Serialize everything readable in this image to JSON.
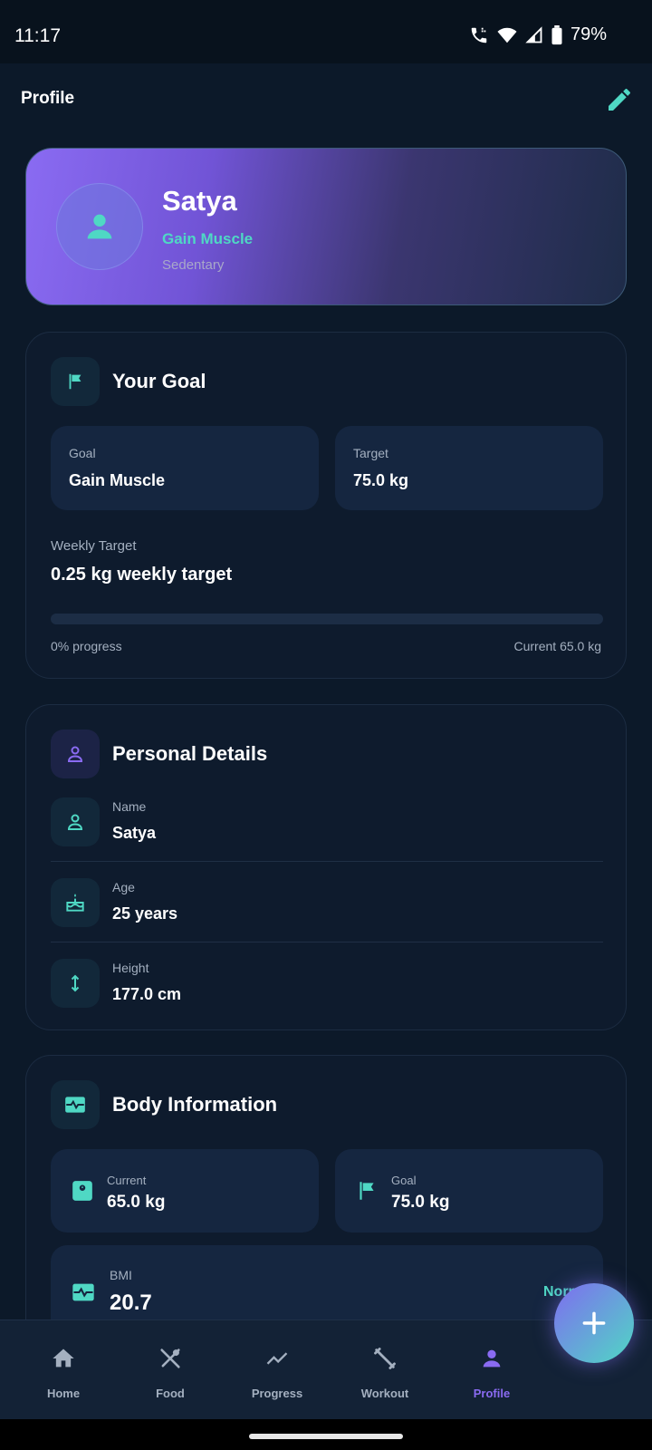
{
  "status_bar": {
    "time": "11:17",
    "battery": "79%"
  },
  "header": {
    "title": "Profile"
  },
  "profile": {
    "name": "Satya",
    "goal": "Gain Muscle",
    "activity": "Sedentary"
  },
  "goal_card": {
    "title": "Your Goal",
    "goal_label": "Goal",
    "goal_value": "Gain Muscle",
    "target_label": "Target",
    "target_value": "75.0 kg",
    "weekly_label": "Weekly Target",
    "weekly_value": "0.25 kg weekly target",
    "progress_fraction": 0,
    "progress_text": "0% progress",
    "current_text": "Current 65.0 kg"
  },
  "personal_card": {
    "title": "Personal Details",
    "rows": [
      {
        "label": "Name",
        "value": "Satya"
      },
      {
        "label": "Age",
        "value": "25 years"
      },
      {
        "label": "Height",
        "value": "177.0 cm"
      }
    ]
  },
  "body_card": {
    "title": "Body Information",
    "current_label": "Current",
    "current_value": "65.0 kg",
    "goal_label": "Goal",
    "goal_value": "75.0 kg",
    "bmi_label": "BMI",
    "bmi_value": "20.7",
    "bmi_status": "Norm"
  },
  "nav": {
    "items": [
      {
        "label": "Home",
        "icon": "home-icon"
      },
      {
        "label": "Food",
        "icon": "utensils-icon"
      },
      {
        "label": "Progress",
        "icon": "trending-icon"
      },
      {
        "label": "Workout",
        "icon": "dumbbell-icon"
      },
      {
        "label": "Profile",
        "icon": "person-icon"
      }
    ],
    "active": "Profile"
  },
  "colors": {
    "accent": "#4fd8c4",
    "purple": "#8a6bf2",
    "background": "#0c1929",
    "card": "#0e1b2d",
    "tile": "#152640"
  }
}
